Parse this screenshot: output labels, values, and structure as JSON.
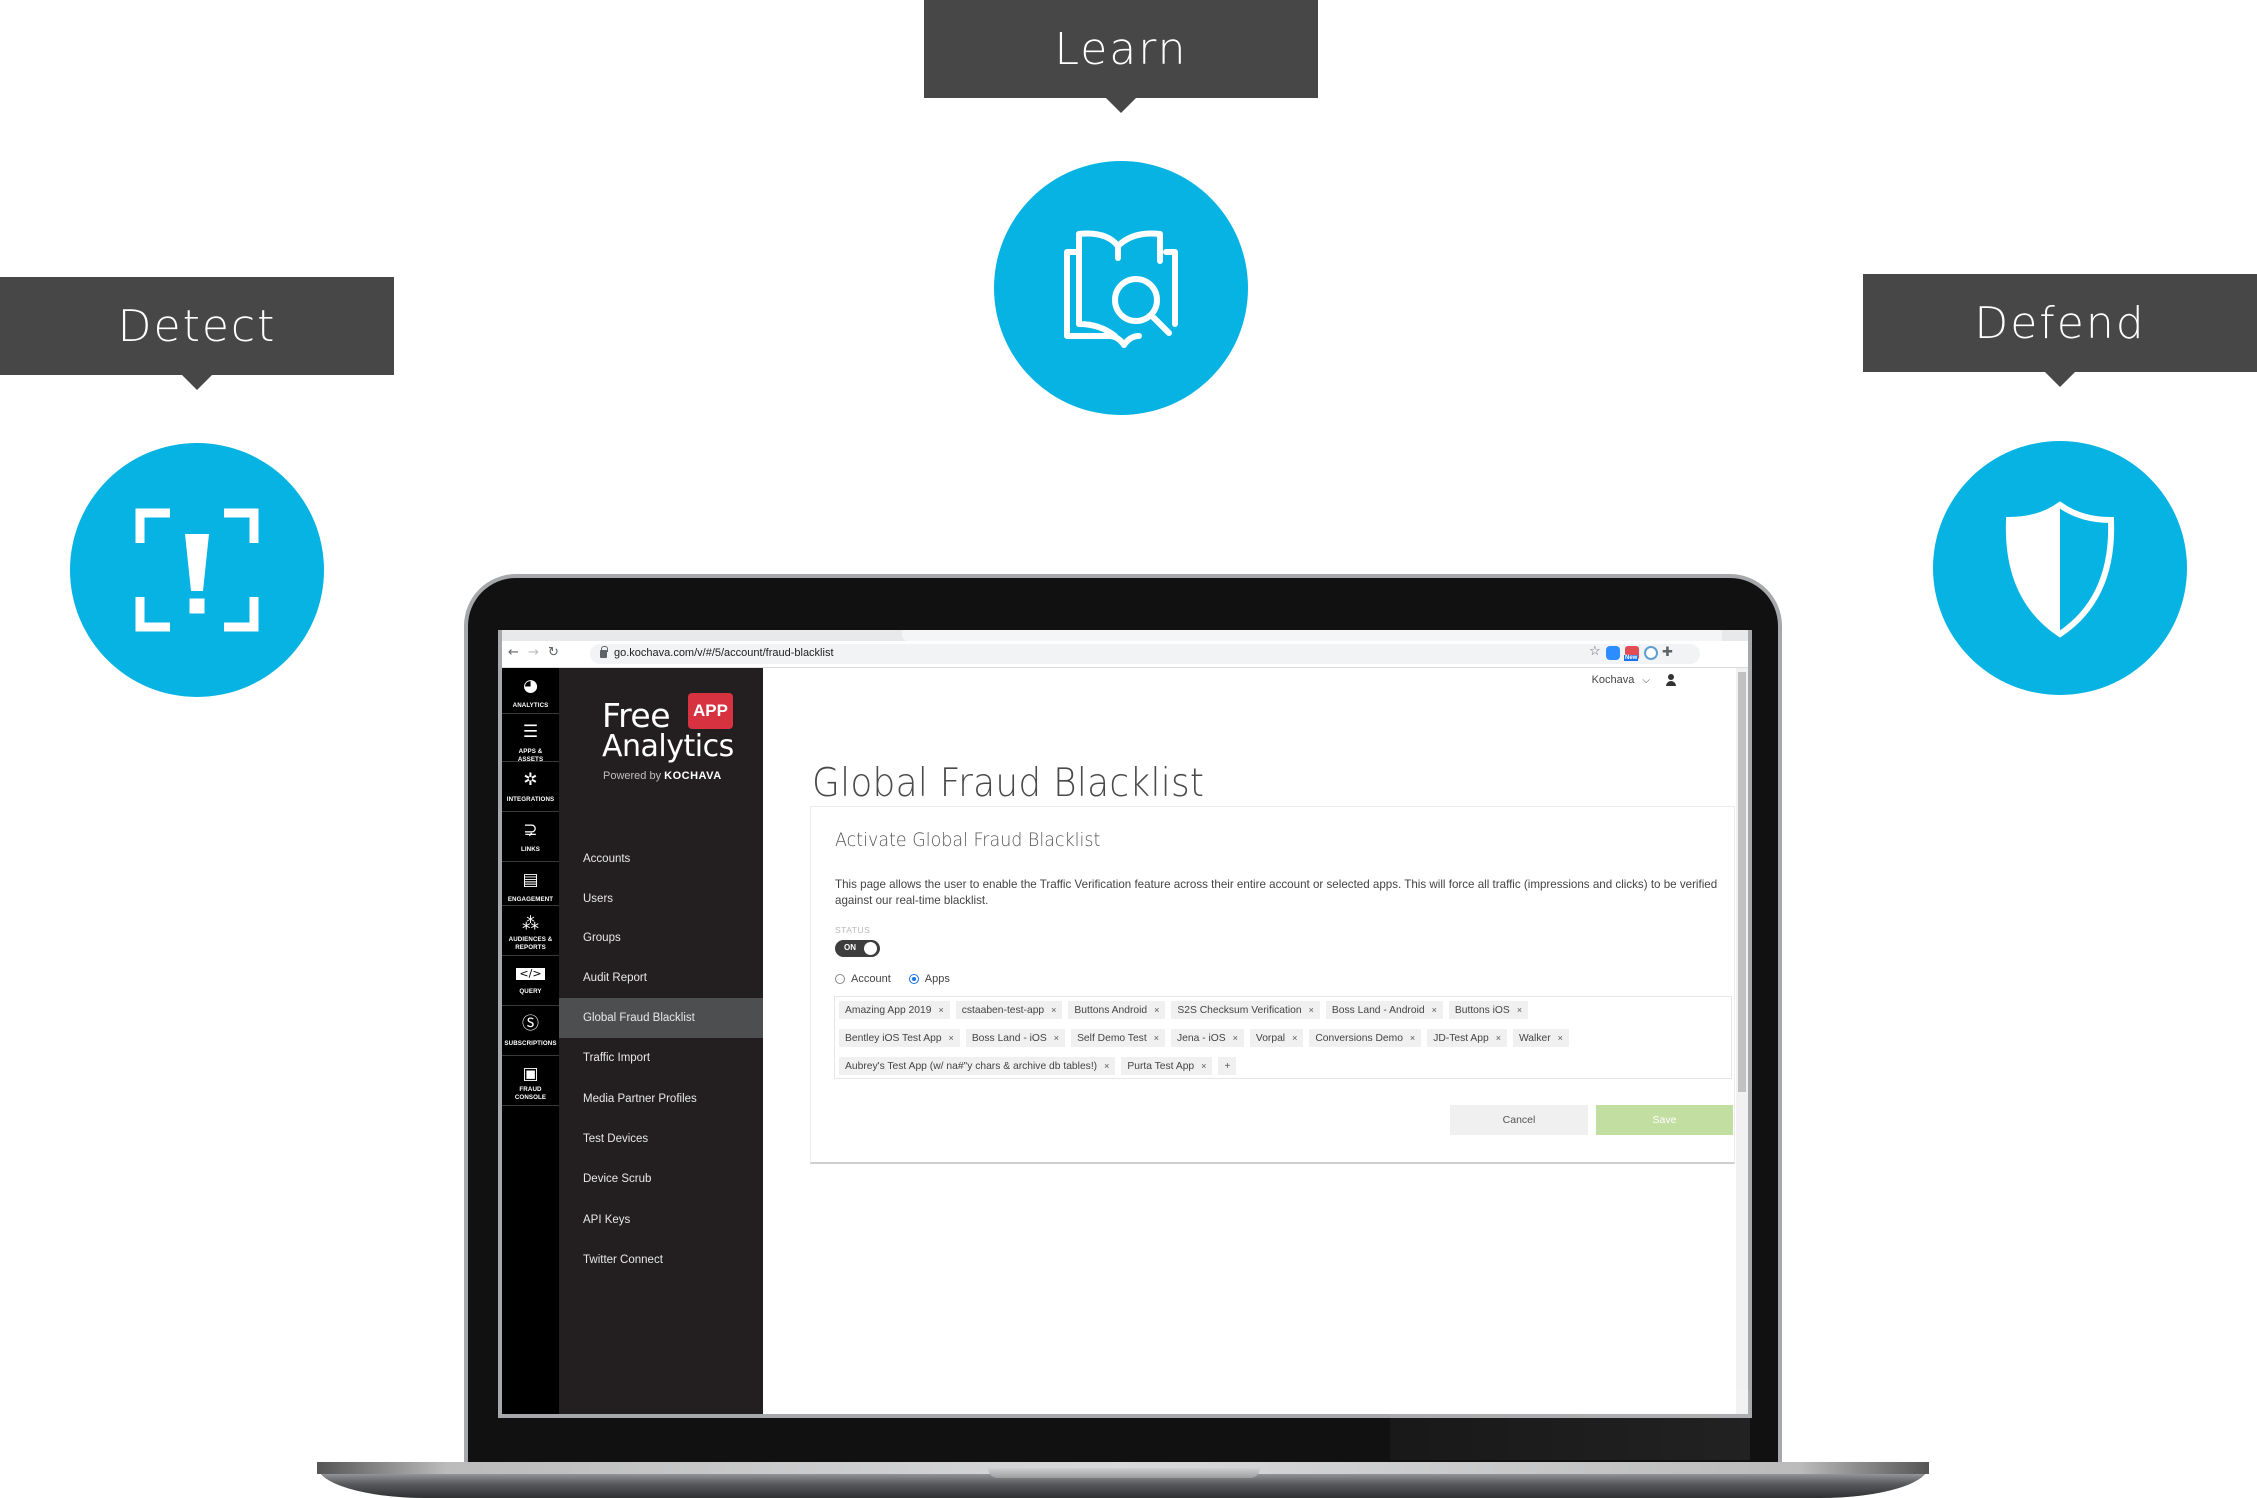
{
  "callouts": [
    {
      "id": "detect",
      "label": "Detect",
      "icon": "alert-frame-icon"
    },
    {
      "id": "learn",
      "label": "Learn",
      "icon": "book-search-icon"
    },
    {
      "id": "defend",
      "label": "Defend",
      "icon": "shield-icon"
    }
  ],
  "colors": {
    "accent": "#06b3e2",
    "callout_bg": "#474747",
    "brand_red": "#d6323f",
    "save_green": "#c2dea0"
  },
  "browser": {
    "url": "go.kochava.com/v/#/5/account/fraud-blacklist",
    "ext_new_badge": "New"
  },
  "rail": {
    "items": [
      {
        "label": "ANALYTICS",
        "icon": "dashboard-icon"
      },
      {
        "label": "APPS & ASSETS",
        "icon": "list-icon"
      },
      {
        "label": "INTEGRATIONS",
        "icon": "gear-icon"
      },
      {
        "label": "LINKS",
        "icon": "link-path-icon"
      },
      {
        "label": "ENGAGEMENT",
        "icon": "chat-icon"
      },
      {
        "label": "AUDIENCES & REPORTS",
        "icon": "org-chart-icon"
      },
      {
        "label": "QUERY",
        "icon": "code-window-icon"
      },
      {
        "label": "SUBSCRIPTIONS",
        "icon": "dollar-cycle-icon"
      },
      {
        "label": "FRAUD CONSOLE",
        "icon": "monitor-icon"
      }
    ]
  },
  "logo": {
    "free": "Free",
    "app": "APP",
    "analytics": "Analytics",
    "powered": "Powered by",
    "brand": "KOCHAVA"
  },
  "sidebar": {
    "items": [
      {
        "label": "Accounts"
      },
      {
        "label": "Users"
      },
      {
        "label": "Groups"
      },
      {
        "label": "Audit Report"
      },
      {
        "label": "Global Fraud Blacklist",
        "active": true
      },
      {
        "label": "Traffic Import"
      },
      {
        "label": "Media Partner Profiles"
      },
      {
        "label": "Test Devices"
      },
      {
        "label": "Device Scrub"
      },
      {
        "label": "API Keys"
      },
      {
        "label": "Twitter Connect"
      }
    ]
  },
  "header": {
    "account": "Kochava"
  },
  "page": {
    "title": "Global Fraud Blacklist",
    "card_title": "Activate Global Fraud Blacklist",
    "description": "This page allows the user to enable the Traffic Verification feature across their entire account or selected apps. This will force all traffic (impressions and clicks) to be verified against our real-time blacklist.",
    "status_label": "STATUS",
    "toggle_label": "ON",
    "toggle_on": true,
    "radio_account": "Account",
    "radio_apps": "Apps",
    "selected_scope": "Apps",
    "tag_rows": [
      [
        "Amazing App 2019",
        "cstaaben-test-app",
        "Buttons Android",
        "S2S Checksum Verification",
        "Boss Land - Android",
        "Buttons iOS"
      ],
      [
        "Bentley iOS Test App",
        "Boss Land - iOS",
        "Self Demo Test",
        "Jena - iOS",
        "Vorpal",
        "Conversions Demo",
        "JD-Test App",
        "Walker"
      ],
      [
        "Aubrey's Test App (w/ na#\"y chars & archive db tables!)",
        "Purta Test App"
      ]
    ],
    "tag_remove": "×",
    "tag_add": "+",
    "cancel_label": "Cancel",
    "save_label": "Save"
  }
}
